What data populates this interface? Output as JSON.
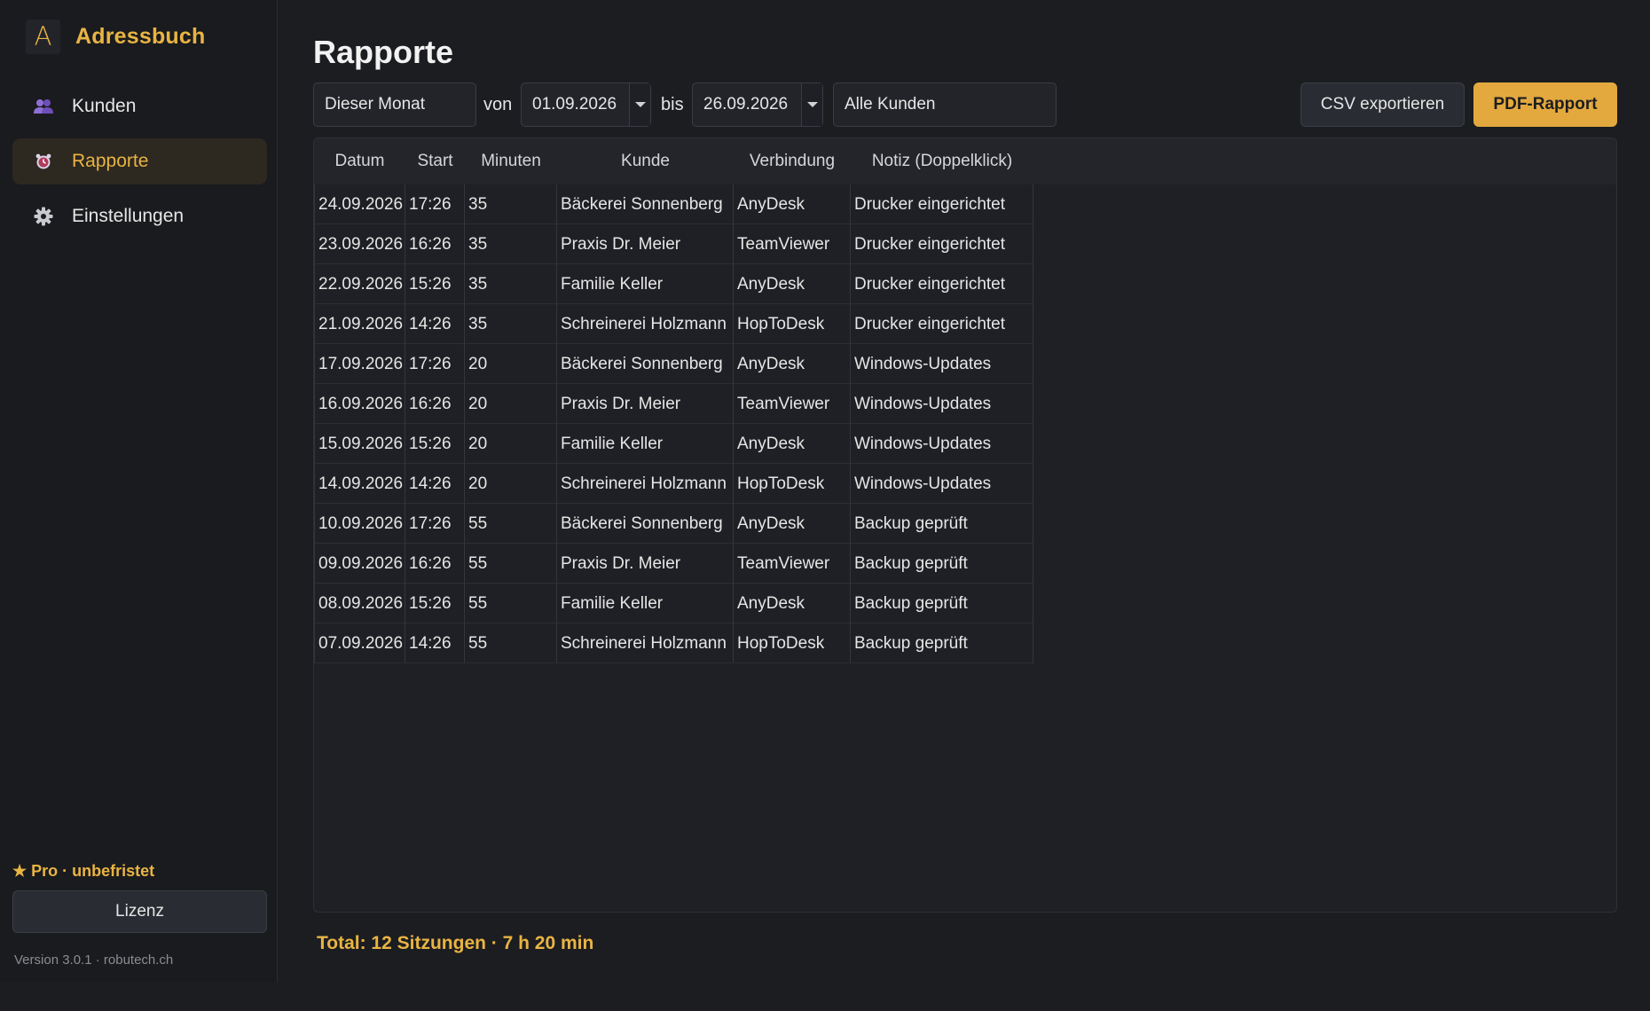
{
  "sidebar": {
    "logo_letter": "A",
    "app_name": "Adressbuch",
    "items": [
      {
        "label": "Kunden",
        "icon": "users-icon"
      },
      {
        "label": "Rapporte",
        "icon": "alarm-clock-icon",
        "active": true
      },
      {
        "label": "Einstellungen",
        "icon": "gear-icon"
      }
    ],
    "pro_label": "★ Pro · unbefristet",
    "license_button": "Lizenz",
    "version": "Version 3.0.1 · robutech.ch"
  },
  "main": {
    "title": "Rapporte",
    "filters": {
      "period": "Dieser Monat",
      "from_label": "von",
      "from_date": "01.09.2026",
      "to_label": "bis",
      "to_date": "26.09.2026",
      "customer": "Alle Kunden"
    },
    "buttons": {
      "csv": "CSV exportieren",
      "pdf": "PDF-Rapport"
    },
    "table": {
      "columns": [
        "Datum",
        "Start",
        "Minuten",
        "Kunde",
        "Verbindung",
        "Notiz (Doppelklick)"
      ],
      "rows": [
        [
          "24.09.2026",
          "17:26",
          "35",
          "Bäckerei Sonnenberg",
          "AnyDesk",
          "Drucker eingerichtet"
        ],
        [
          "23.09.2026",
          "16:26",
          "35",
          "Praxis Dr. Meier",
          "TeamViewer",
          "Drucker eingerichtet"
        ],
        [
          "22.09.2026",
          "15:26",
          "35",
          "Familie Keller",
          "AnyDesk",
          "Drucker eingerichtet"
        ],
        [
          "21.09.2026",
          "14:26",
          "35",
          "Schreinerei Holzmann",
          "HopToDesk",
          "Drucker eingerichtet"
        ],
        [
          "17.09.2026",
          "17:26",
          "20",
          "Bäckerei Sonnenberg",
          "AnyDesk",
          "Windows-Updates"
        ],
        [
          "16.09.2026",
          "16:26",
          "20",
          "Praxis Dr. Meier",
          "TeamViewer",
          "Windows-Updates"
        ],
        [
          "15.09.2026",
          "15:26",
          "20",
          "Familie Keller",
          "AnyDesk",
          "Windows-Updates"
        ],
        [
          "14.09.2026",
          "14:26",
          "20",
          "Schreinerei Holzmann",
          "HopToDesk",
          "Windows-Updates"
        ],
        [
          "10.09.2026",
          "17:26",
          "55",
          "Bäckerei Sonnenberg",
          "AnyDesk",
          "Backup geprüft"
        ],
        [
          "09.09.2026",
          "16:26",
          "55",
          "Praxis Dr. Meier",
          "TeamViewer",
          "Backup geprüft"
        ],
        [
          "08.09.2026",
          "15:26",
          "55",
          "Familie Keller",
          "AnyDesk",
          "Backup geprüft"
        ],
        [
          "07.09.2026",
          "14:26",
          "55",
          "Schreinerei Holzmann",
          "HopToDesk",
          "Backup geprüft"
        ]
      ]
    },
    "total": "Total: 12 Sitzungen · 7 h 20 min"
  },
  "colors": {
    "accent": "#e9b443",
    "background": "#1c1d21",
    "sidebar": "#1a1b1e"
  }
}
